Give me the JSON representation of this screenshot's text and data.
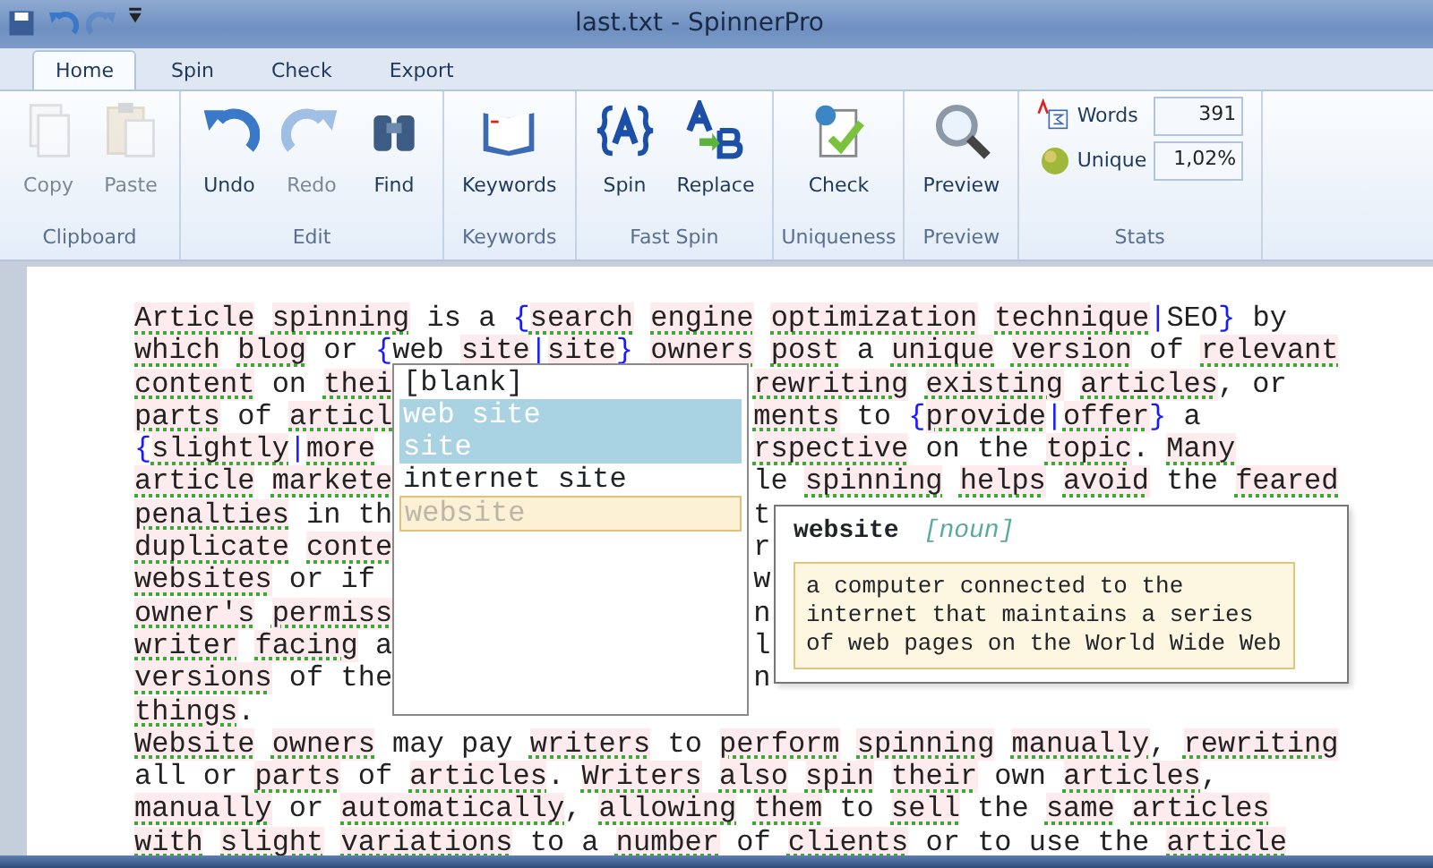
{
  "window": {
    "title": "last.txt - SpinnerPro"
  },
  "quick_access": [
    {
      "disabled": false
    },
    {
      "disabled": false
    },
    {
      "disabled": true
    },
    {
      "disabled": false
    }
  ],
  "tabs": [
    {
      "label": "Home",
      "selected": true
    },
    {
      "label": "Spin",
      "selected": false
    },
    {
      "label": "Check",
      "selected": false
    },
    {
      "label": "Export",
      "selected": false
    }
  ],
  "ribbon_groups": [
    {
      "label": "Clipboard",
      "buttons": [
        {
          "label": "Copy",
          "disabled": true
        },
        {
          "label": "Paste",
          "disabled": true
        }
      ]
    },
    {
      "label": "Edit",
      "buttons": [
        {
          "label": "Undo",
          "disabled": false
        },
        {
          "label": "Redo",
          "disabled": true
        },
        {
          "label": "Find",
          "disabled": false
        }
      ]
    },
    {
      "label": "Keywords",
      "buttons": [
        {
          "label": "Keywords",
          "disabled": false
        }
      ]
    },
    {
      "label": "Fast Spin",
      "buttons": [
        {
          "label": "Spin",
          "disabled": false
        },
        {
          "label": "Replace",
          "disabled": false
        }
      ]
    },
    {
      "label": "Uniqueness",
      "buttons": [
        {
          "label": "Check",
          "disabled": false
        }
      ]
    },
    {
      "label": "Preview",
      "buttons": [
        {
          "label": "Preview",
          "disabled": false
        }
      ]
    },
    {
      "label": "Stats",
      "stats": [
        {
          "label": "Words",
          "value": "391"
        },
        {
          "label": "Unique",
          "value": "1,02%"
        }
      ]
    }
  ],
  "editor": {
    "lines": [
      {
        "left": "Article spinning is a {search engine optimization technique|SEO} by"
      },
      {
        "left": "which blog or {web site|site} owners post a unique version of relevant"
      },
      {
        "left": "content on thei",
        "right": "rewriting existing articles, or"
      },
      {
        "left": "parts of articl",
        "right": "ments to {provide|offer} a"
      },
      {
        "left": "{slightly|more ",
        "right": "rspective on the topic. Many"
      },
      {
        "left": "article markete",
        "right": "le spinning helps avoid the feared"
      },
      {
        "left": "penalties in th",
        "right": "t"
      },
      {
        "left": "duplicate conte",
        "right": "r"
      },
      {
        "left": "websites or if ",
        "right": "w"
      },
      {
        "left": "owner's permiss",
        "right": "n"
      },
      {
        "left": "writer facing a",
        "right": "l"
      },
      {
        "left": "versions of the",
        "right": "n"
      },
      {
        "left": "things."
      },
      {
        "left": "Website owners may pay writers to perform spinning manually, rewriting"
      },
      {
        "left": "all or parts of articles. Writers also spin their own articles,"
      },
      {
        "left": "manually or automatically, allowing them to sell the same articles"
      },
      {
        "left": "with slight variations to a number of clients or to use the article"
      }
    ]
  },
  "suggestions": [
    {
      "label": "[blank]",
      "selected": false,
      "hovered": false
    },
    {
      "label": "web site",
      "selected": true,
      "hovered": false
    },
    {
      "label": "site",
      "selected": true,
      "hovered": false
    },
    {
      "label": "internet site",
      "selected": false,
      "hovered": false
    },
    {
      "label": "website",
      "selected": false,
      "hovered": true
    }
  ],
  "definition": {
    "word": "website",
    "part_of_speech": "[noun]",
    "text": "a computer connected to the internet that maintains a series of web pages on the World Wide Web"
  }
}
